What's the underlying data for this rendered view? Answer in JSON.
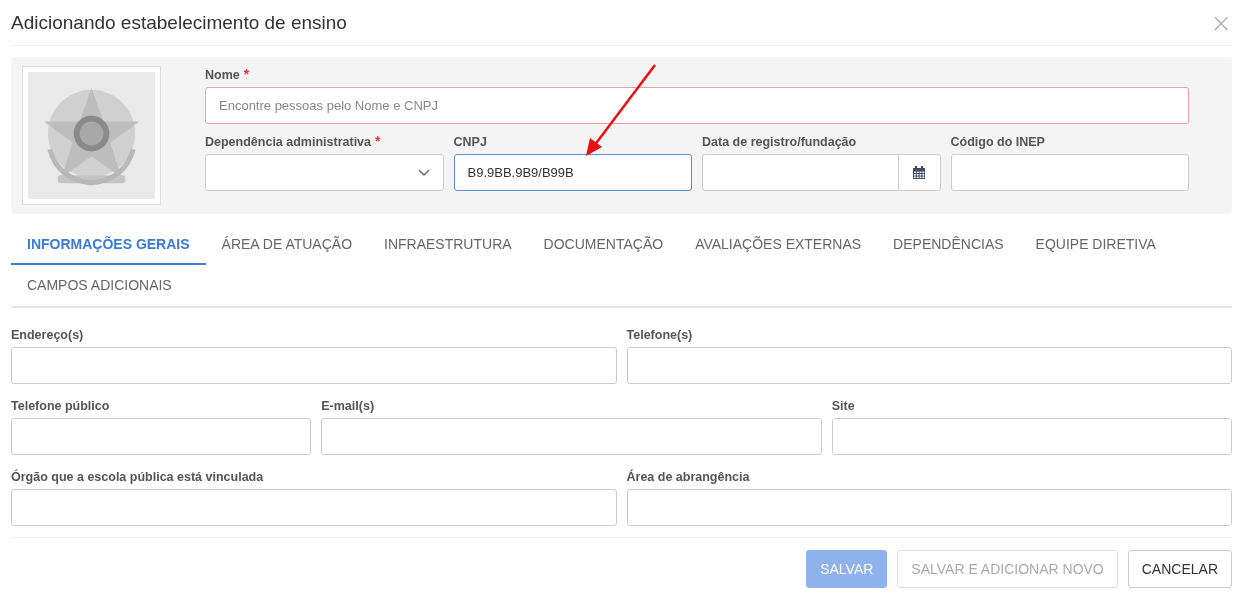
{
  "dialog": {
    "title": "Adicionando estabelecimento de ensino",
    "close": "×"
  },
  "header": {
    "logo": {
      "kind": "picture"
    },
    "rows": [
      [
        {
          "label": "Nome",
          "required_mark": "*",
          "kind": "text",
          "placeholder": "Encontre pessoas pelo Nome e CNPJ",
          "invalid": true,
          "focused": false
        }
      ],
      [
        {
          "label": "Dependência administrativa",
          "required_mark": "*",
          "kind": "select",
          "invalid": false,
          "focused": false
        },
        {
          "label": "CNPJ",
          "kind": "text",
          "value": "B9.9BB.9B9/B99B",
          "invalid": false,
          "focused": true
        },
        {
          "label": "Data de registro/fundação",
          "kind": "date",
          "invalid": false,
          "focused": false
        },
        {
          "label": "Código do INEP",
          "kind": "text",
          "invalid": false,
          "focused": false
        }
      ]
    ]
  },
  "tabs": [
    {
      "label": "INFORMAÇÕES GERAIS",
      "selected": true
    },
    {
      "label": "ÁREA DE ATUAÇÃO",
      "selected": false
    },
    {
      "label": "INFRAESTRUTURA",
      "selected": false
    },
    {
      "label": "DOCUMENTAÇÃO",
      "selected": false
    },
    {
      "label": "AVALIAÇÕES EXTERNAS",
      "selected": false
    },
    {
      "label": "DEPENDÊNCIAS",
      "selected": false
    },
    {
      "label": "EQUIPE DIRETIVA",
      "selected": false
    },
    {
      "label": "CAMPOS ADICIONAIS",
      "selected": false
    }
  ],
  "form": {
    "rows": [
      [
        {
          "label": "Endereço(s)"
        },
        {
          "label": "Telefone(s)"
        }
      ],
      [
        {
          "label": "Telefone público"
        },
        {
          "label": "E-mail(s)"
        },
        {
          "label": "Site"
        }
      ],
      [
        {
          "label": "Órgão que a escola pública está vinculada"
        },
        {
          "label": "Área de abrangência"
        }
      ]
    ]
  },
  "buttons": [
    {
      "label": "SALVAR",
      "kind": "primary",
      "disabled": true
    },
    {
      "label": "SALVAR E ADICIONAR NOVO",
      "kind": "default",
      "disabled": true
    },
    {
      "label": "CANCELAR",
      "kind": "default",
      "disabled": false
    }
  ]
}
